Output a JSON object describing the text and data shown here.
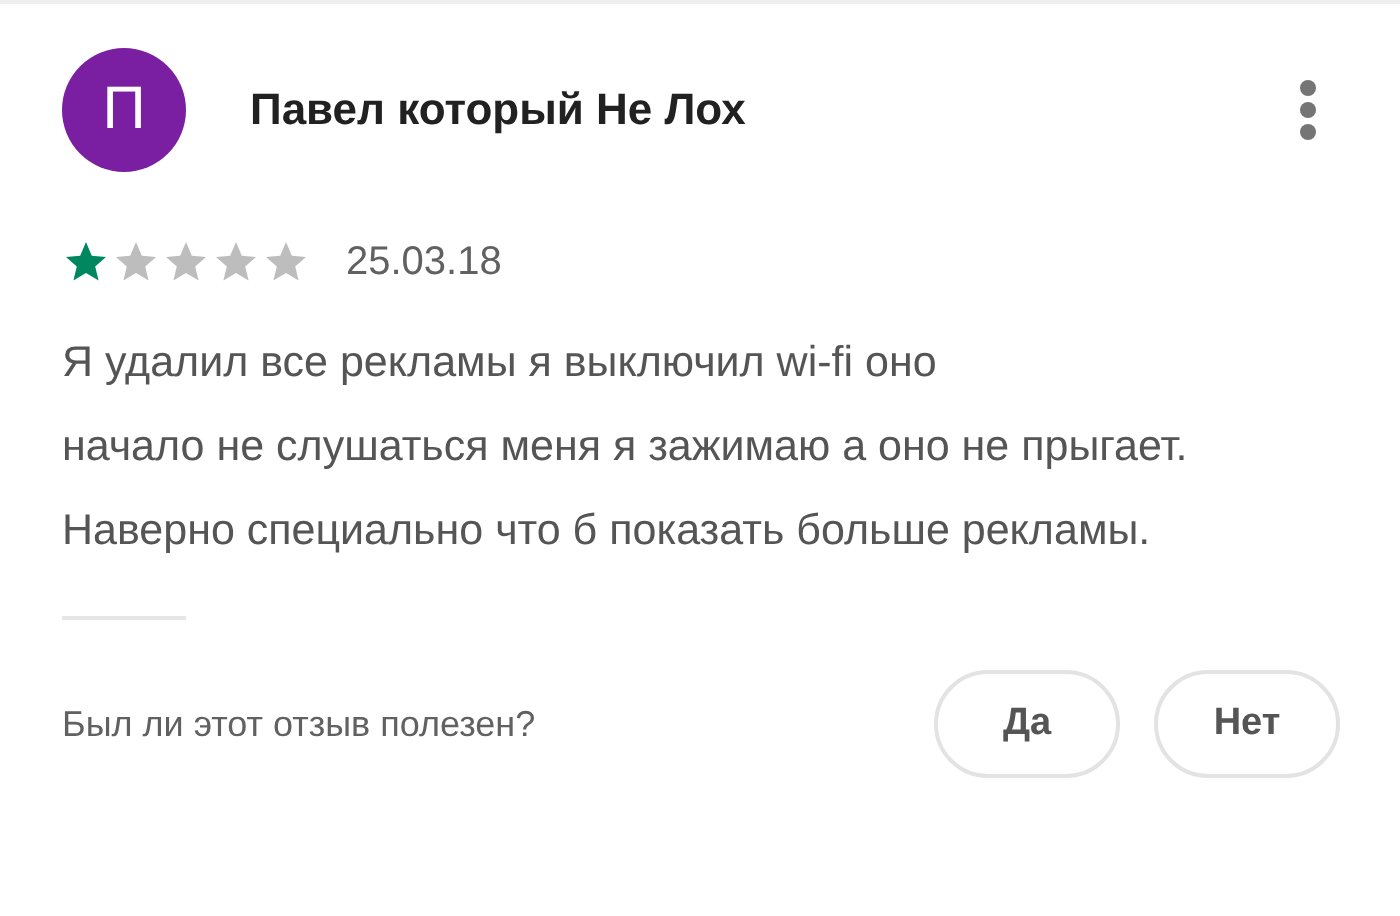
{
  "review": {
    "avatar_letter": "П",
    "author": "Павел который Не Лох",
    "stars": 1,
    "date": "25.03.18",
    "text": "Я удалил все рекламы я выключил wi-fi оно\nначало не слушаться меня я зажимаю а оно не прыгает. Наверно специально что б показать больше рекламы."
  },
  "helpful": {
    "question": "Был ли этот отзыв полезен?",
    "buttons": [
      "Да",
      "Нет"
    ]
  }
}
